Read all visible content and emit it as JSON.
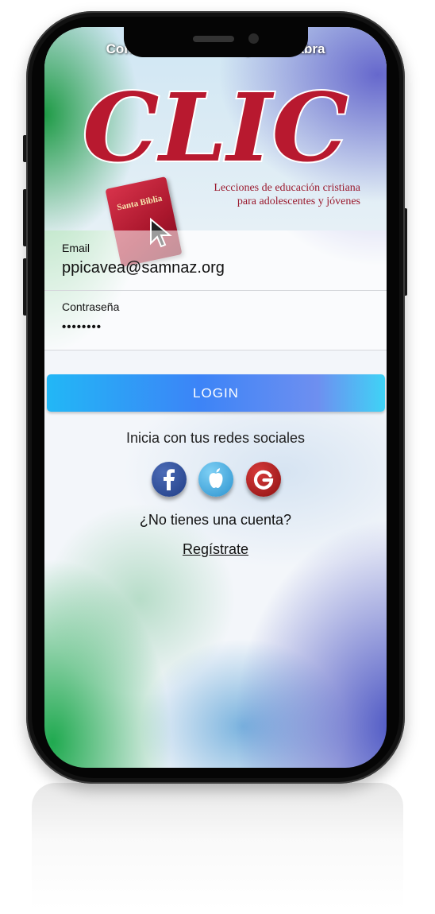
{
  "header": {
    "tagline": "Conéctate con Cristo y su Palabra",
    "logo_text": "CLIC",
    "book_title": "Santa Biblia",
    "subtitle_line1": "Lecciones de educación cristiana",
    "subtitle_line2": "para adolescentes y jóvenes"
  },
  "form": {
    "email_label": "Email",
    "email_value": "ppicavea@samnaz.org",
    "password_label": "Contraseña",
    "password_value": "••••••••",
    "login_label": "LOGIN"
  },
  "social": {
    "caption": "Inicia con tus redes sociales",
    "buttons": [
      {
        "name": "facebook",
        "icon": "facebook-icon"
      },
      {
        "name": "apple",
        "icon": "apple-icon"
      },
      {
        "name": "google",
        "icon": "google-icon"
      }
    ]
  },
  "account": {
    "question": "¿No tienes una cuenta?",
    "register_label": "Regístrate"
  },
  "colors": {
    "logo_red": "#b8192f",
    "login_gradient_start": "#22b7f6",
    "login_gradient_end": "#3fd3f6",
    "facebook": "#2a4a95",
    "apple": "#3aa3dc",
    "google": "#b11d1d"
  }
}
